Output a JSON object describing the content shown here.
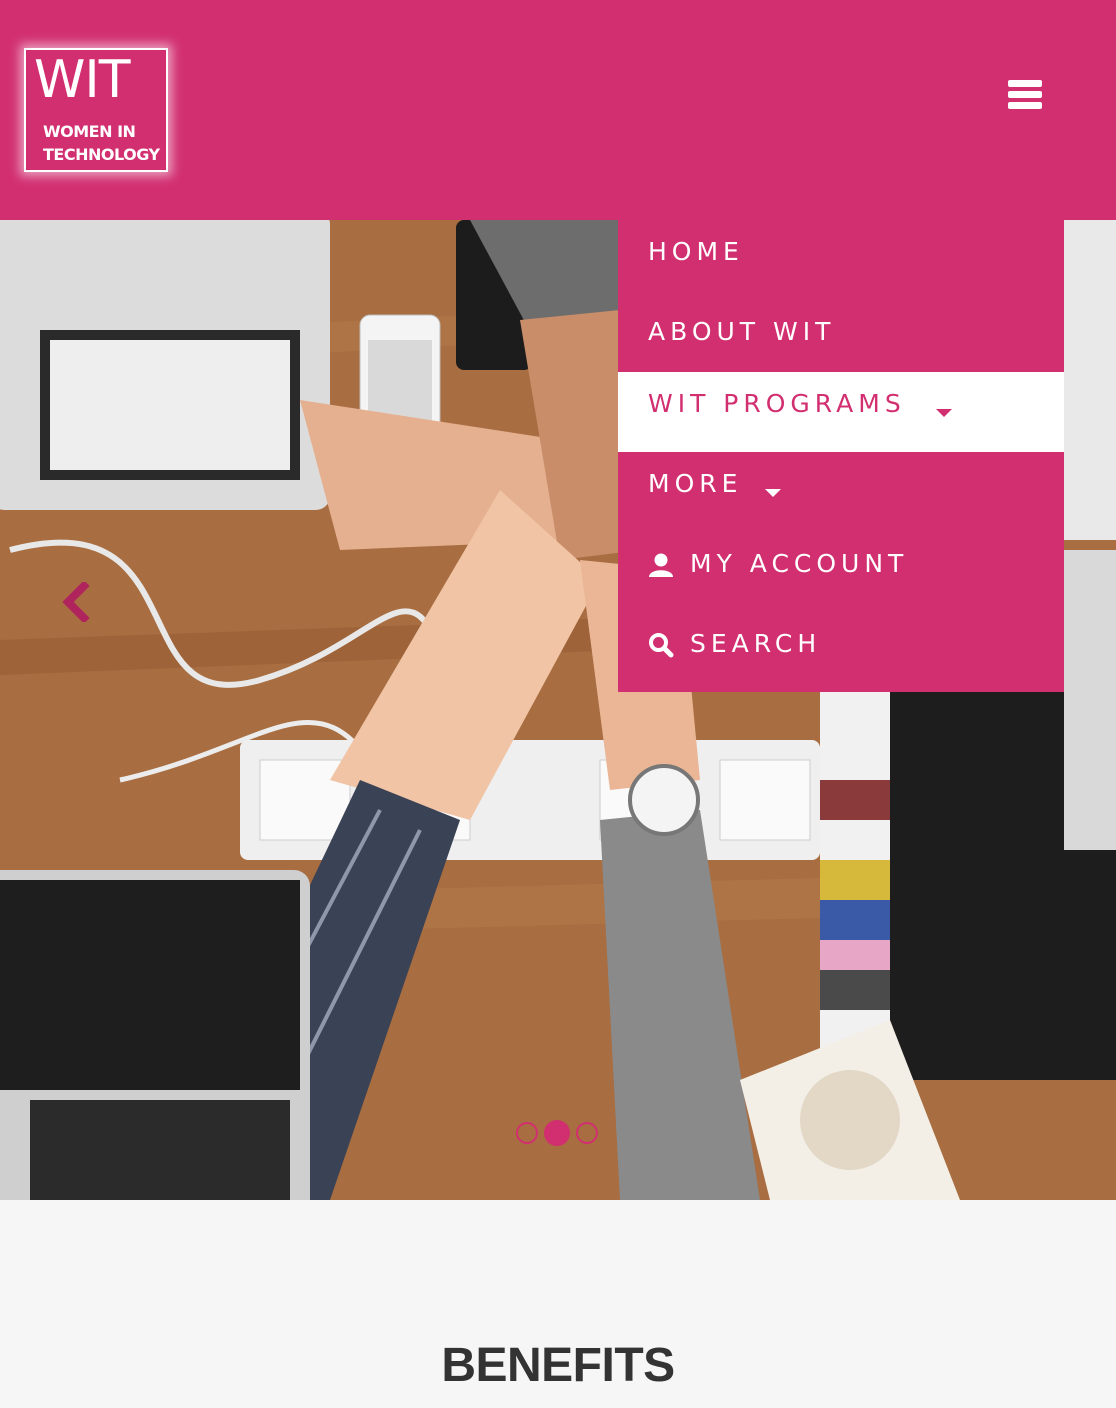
{
  "header": {
    "logo": {
      "big": "WIT",
      "line1": "WOMEN IN",
      "line2": "TECHNOLOGY"
    },
    "menu_icon": "hamburger-icon"
  },
  "hero": {
    "prev_icon": "chevron-left-icon",
    "slides_total": 3,
    "active_slide": 2
  },
  "menu": {
    "items": [
      {
        "label": "HOME"
      },
      {
        "label": "ABOUT WIT"
      },
      {
        "label": "WIT PROGRAMS",
        "has_caret": true,
        "active": true
      },
      {
        "label": "MORE",
        "has_caret": true
      },
      {
        "label": "MY ACCOUNT",
        "icon": "user-icon"
      },
      {
        "label": "SEARCH",
        "icon": "search-icon"
      }
    ]
  },
  "benefits": {
    "title": "BENEFITS"
  },
  "colors": {
    "brand": "#d22f71",
    "background": "#f6f6f6",
    "heading": "#333333"
  }
}
